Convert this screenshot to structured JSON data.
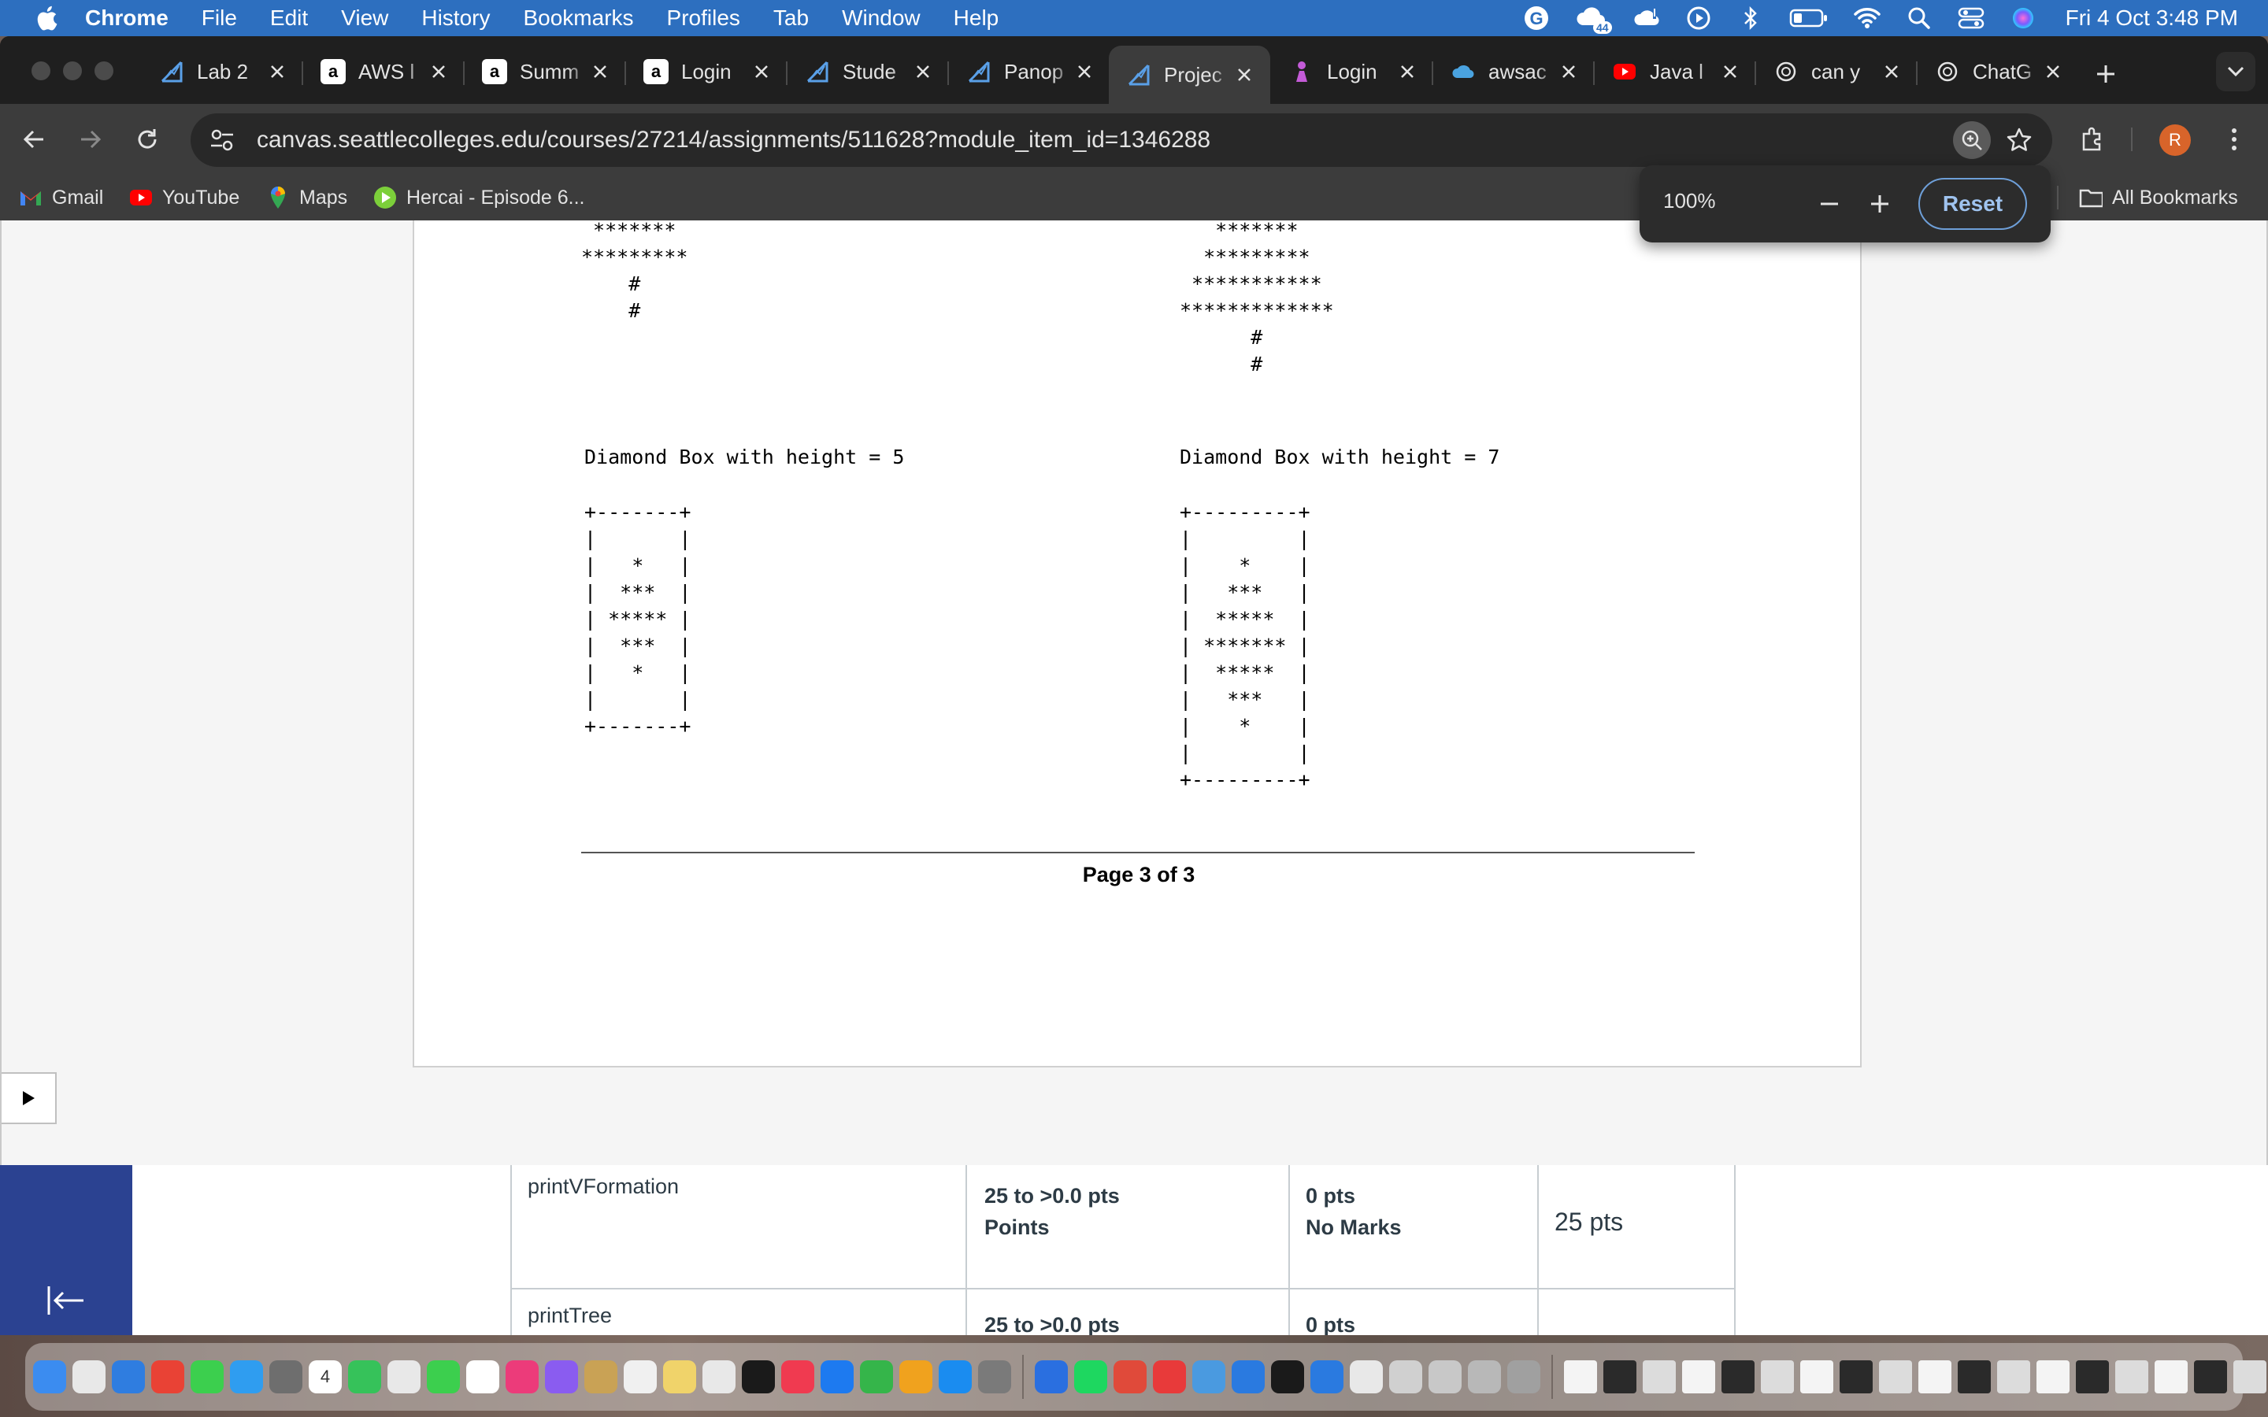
{
  "menubar": {
    "app": "Chrome",
    "items": [
      "File",
      "Edit",
      "View",
      "History",
      "Bookmarks",
      "Profiles",
      "Tab",
      "Window",
      "Help"
    ],
    "badge": "44",
    "clock": "Fri 4 Oct  3:48 PM"
  },
  "tabs": [
    {
      "label": "Lab 2",
      "icon": "canvas-icon"
    },
    {
      "label": "AWS l",
      "icon": "amazon-icon"
    },
    {
      "label": "Summ",
      "icon": "amazon-icon"
    },
    {
      "label": "Login",
      "icon": "amazon-icon"
    },
    {
      "label": "Stude",
      "icon": "canvas-icon"
    },
    {
      "label": "Panop",
      "icon": "canvas-icon"
    },
    {
      "label": "Projec",
      "icon": "canvas-icon",
      "active": true
    },
    {
      "label": "Login",
      "icon": "figure-icon"
    },
    {
      "label": "awsac",
      "icon": "cloud-icon"
    },
    {
      "label": "Java l",
      "icon": "youtube-icon"
    },
    {
      "label": "can y",
      "icon": "openai-icon"
    },
    {
      "label": "ChatG",
      "icon": "openai-icon"
    }
  ],
  "omnibox": {
    "url": "canvas.seattlecolleges.edu/courses/27214/assignments/511628?module_item_id=1346288"
  },
  "profile_initial": "R",
  "bookmarks": {
    "items": [
      {
        "label": "Gmail",
        "icon": "gmail-icon"
      },
      {
        "label": "YouTube",
        "icon": "youtube-icon"
      },
      {
        "label": "Maps",
        "icon": "maps-icon"
      },
      {
        "label": "Hercai - Episode 6...",
        "icon": "play-icon"
      }
    ],
    "all_bookmarks": "All Bookmarks"
  },
  "zoom_bubble": {
    "level": "100%",
    "reset_label": "Reset"
  },
  "pdf": {
    "left_tree_lines": " *******\n*********\n    #\n    #",
    "right_tree_lines": "   *******\n  *********\n ***********\n*************\n      #\n      #",
    "left_heading": "Diamond Box with height = 5",
    "right_heading": "Diamond Box with height = 7",
    "left_box": "+-------+\n|       |\n|   *   |\n|  ***  |\n| ***** |\n|  ***  |\n|   *   |\n|       |\n+-------+",
    "right_box": "+---------+\n|         |\n|    *    |\n|   ***   |\n|  *****  |\n| ******* |\n|  *****  |\n|   ***   |\n|    *    |\n|         |\n+---------+",
    "footer": "Page 3 of 3"
  },
  "rubric": {
    "rows": [
      {
        "criterion": "printVFormation",
        "full_range": "25 to >0.0 pts",
        "full_label": "Points",
        "none_pts": "0 pts",
        "none_label": "No Marks",
        "total": "25 pts"
      },
      {
        "criterion": "printTree",
        "full_range": "25 to >0.0 pts",
        "full_label": "",
        "none_pts": "0 pts",
        "none_label": "",
        "total": ""
      }
    ]
  },
  "dock": {
    "calendar_day": "4"
  },
  "colors": {
    "menubar": "#2d6fbf",
    "canvas_nav": "#2b4291",
    "reset_accent": "#6e9fd8"
  }
}
